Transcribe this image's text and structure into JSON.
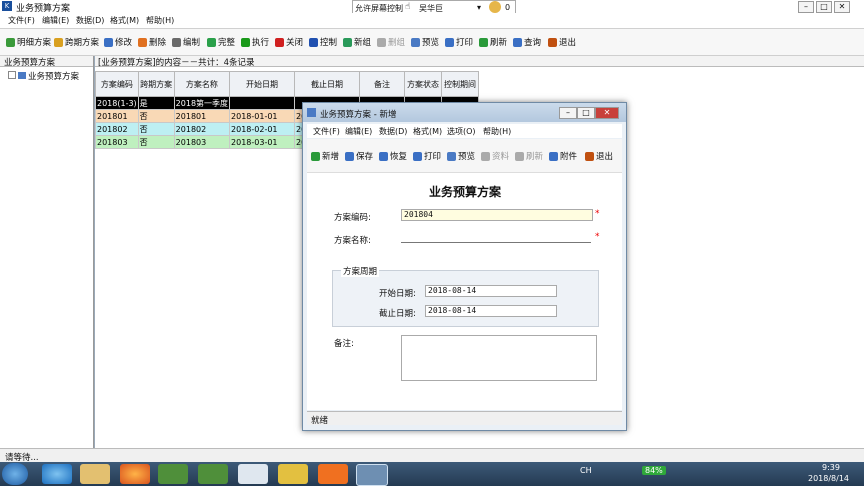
{
  "window": {
    "title": "业务预算方案"
  },
  "remote_bar": {
    "label": "允许屏幕控制",
    "user": "吴华巨",
    "count": "0"
  },
  "menu": [
    "文件(F)",
    "编辑(E)",
    "数据(D)",
    "格式(M)",
    "帮助(H)"
  ],
  "toolbar": [
    {
      "label": "明细方案",
      "color": "#3a9a3a",
      "enabled": true
    },
    {
      "label": "跨期方案",
      "color": "#d9a020",
      "enabled": true
    },
    {
      "label": "修改",
      "color": "#3a6fc4",
      "enabled": true
    },
    {
      "label": "删除",
      "color": "#e07020",
      "enabled": true
    },
    {
      "label": "编制",
      "color": "#6a6a6a",
      "enabled": true
    },
    {
      "label": "完整",
      "color": "#2aa04a",
      "enabled": true
    },
    {
      "label": "执行",
      "color": "#1a9a1a",
      "enabled": true
    },
    {
      "label": "关闭",
      "color": "#d02020",
      "enabled": true
    },
    {
      "label": "控制",
      "color": "#2050b0",
      "enabled": true
    },
    {
      "label": "新组",
      "color": "#2a9a5a",
      "enabled": true
    },
    {
      "label": "删组",
      "color": "#aaaaaa",
      "enabled": false
    },
    {
      "label": "预览",
      "color": "#4a7ac4",
      "enabled": true
    },
    {
      "label": "打印",
      "color": "#3a6fc4",
      "enabled": true
    },
    {
      "label": "刷新",
      "color": "#2a9a3a",
      "enabled": true
    },
    {
      "label": "查询",
      "color": "#3a6fc4",
      "enabled": true
    },
    {
      "label": "退出",
      "color": "#c05010",
      "enabled": true
    }
  ],
  "left_panel": {
    "header": "业务预算方案",
    "tree_item": "业务预算方案"
  },
  "right_panel": {
    "header": "[业务预算方案]的内容－－共计：4条记录"
  },
  "grid": {
    "columns": [
      "方案编码",
      "跨期方案",
      "方案名称",
      "开始日期",
      "截止日期",
      "备注",
      "方案状态",
      "控制期间"
    ],
    "rows": [
      {
        "cells": [
          "2018(1-3)",
          "是",
          "2018第一季度",
          "",
          "",
          "",
          "",
          ""
        ],
        "bg": "#000000",
        "fg": "#ffffff"
      },
      {
        "cells": [
          "201801",
          "否",
          "201801",
          "2018-01-01",
          "2018",
          "",
          "",
          ""
        ],
        "bg": "#f9d9b6",
        "fg": "#000000"
      },
      {
        "cells": [
          "201802",
          "否",
          "201802",
          "2018-02-01",
          "2018",
          "",
          "",
          ""
        ],
        "bg": "#bdeff2",
        "fg": "#000000"
      },
      {
        "cells": [
          "201803",
          "否",
          "201803",
          "2018-03-01",
          "2018",
          "",
          "",
          ""
        ],
        "bg": "#bff0bf",
        "fg": "#000000"
      }
    ]
  },
  "status": "请等待...",
  "dialog": {
    "title": "业务预算方案 - 新增",
    "menu": [
      "文件(F)",
      "编辑(E)",
      "数据(D)",
      "格式(M)",
      "选项(O)",
      "帮助(H)"
    ],
    "toolbar": [
      {
        "label": "新增",
        "color": "#2a9a3a",
        "enabled": true
      },
      {
        "label": "保存",
        "color": "#3a6fc4",
        "enabled": true
      },
      {
        "label": "恢复",
        "color": "#3a6fc4",
        "enabled": true
      },
      {
        "label": "打印",
        "color": "#3a6fc4",
        "enabled": true
      },
      {
        "label": "预览",
        "color": "#4a7ac4",
        "enabled": true
      },
      {
        "label": "资料",
        "color": "#aaaaaa",
        "enabled": false
      },
      {
        "label": "刷新",
        "color": "#aaaaaa",
        "enabled": false
      },
      {
        "label": "附件",
        "color": "#3a6fc4",
        "enabled": true
      },
      {
        "label": "退出",
        "color": "#c05010",
        "enabled": true
      }
    ],
    "heading": "业务预算方案",
    "code_label": "方案编码:",
    "code_value": "201804",
    "name_label": "方案名称:",
    "name_value": "",
    "period_group": "方案周期",
    "start_label": "开始日期:",
    "start_value": "2018-08-14",
    "end_label": "截止日期:",
    "end_value": "2018-08-14",
    "note_label": "备注:",
    "note_value": "",
    "required_mark": "*",
    "status": "就绪"
  },
  "tray": {
    "battery": "84%",
    "time": "9:39",
    "date": "2018/8/14",
    "lang": "CH"
  }
}
